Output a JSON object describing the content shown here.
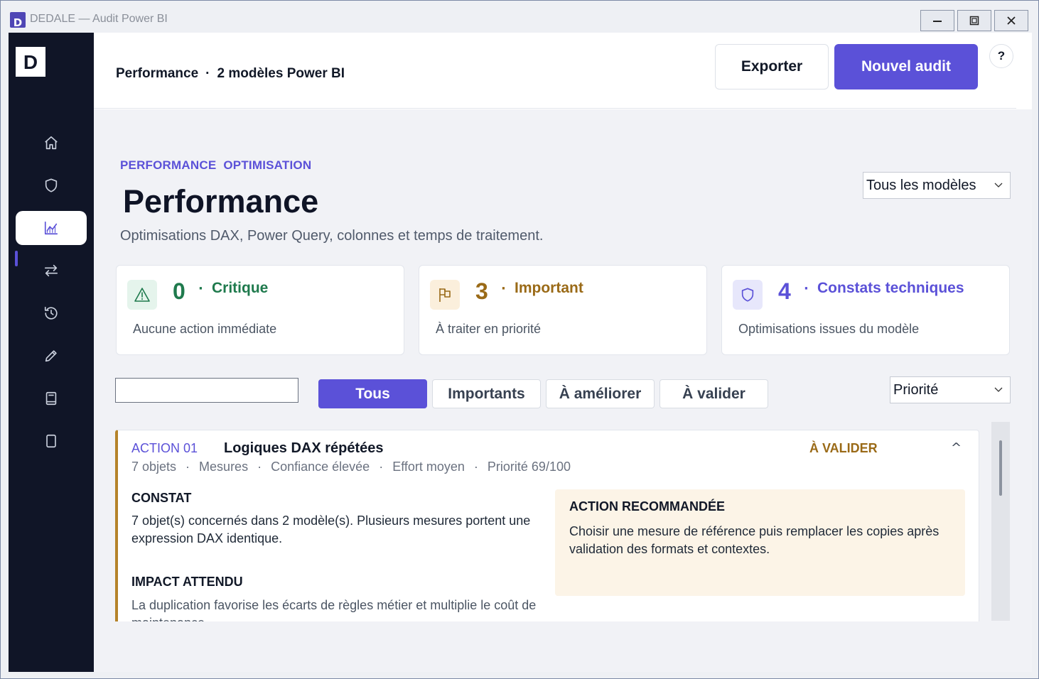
{
  "window": {
    "app_icon_letter": "D",
    "title": "DEDALE — Audit Power BI"
  },
  "sidebar": {
    "logo": "D",
    "items": [
      {
        "icon": "home-icon"
      },
      {
        "icon": "shield-icon"
      },
      {
        "icon": "chart-icon",
        "active": true
      },
      {
        "icon": "swap-arrows-icon"
      },
      {
        "icon": "history-icon"
      },
      {
        "icon": "pencil-icon"
      },
      {
        "icon": "book-icon"
      },
      {
        "icon": "document-icon"
      }
    ]
  },
  "header": {
    "breadcrumb_section": "Performance",
    "breadcrumb_sep": "·",
    "breadcrumb_detail": "2 modèles Power BI",
    "export_label": "Exporter",
    "new_audit_label": "Nouvel audit",
    "help_label": "?"
  },
  "page": {
    "eyebrow_1": "PERFORMANCE",
    "eyebrow_2": "OPTIMISATION",
    "title": "Performance",
    "subtitle": "Optimisations DAX, Power Query, colonnes et temps de traitement.",
    "model_select_value": "Tous les modèles"
  },
  "stats": [
    {
      "count": "0",
      "dot": "·",
      "label": "Critique",
      "desc": "Aucune action immédiate",
      "icon": "warning-icon",
      "color": "#1f7a4d"
    },
    {
      "count": "3",
      "dot": "·",
      "label": "Important",
      "desc": "À traiter en priorité",
      "icon": "flag-icon",
      "color": "#9a6a17"
    },
    {
      "count": "4",
      "dot": "·",
      "label": "Constats techniques",
      "desc": "Optimisations issues du modèle",
      "icon": "shield-icon",
      "color": "#5b51d8"
    }
  ],
  "filters": {
    "search_value": "",
    "chips": [
      "Tous",
      "Importants",
      "À améliorer",
      "À valider"
    ],
    "active_chip": "Tous",
    "sort_value": "Priorité"
  },
  "action": {
    "code": "ACTION 01",
    "title": "Logiques DAX répétées",
    "status": "À VALIDER",
    "toggle": "^",
    "meta": [
      "7 objets",
      "Mesures",
      "Confiance élevée",
      "Effort moyen",
      "Priorité 69/100"
    ],
    "meta_sep": "·",
    "constat_heading": "CONSTAT",
    "constat_text": "7 objet(s) concernés dans 2 modèle(s). Plusieurs mesures portent une expression DAX identique.",
    "impact_heading": "IMPACT ATTENDU",
    "impact_text": "La duplication favorise les écarts de règles métier et multiplie le coût de maintenance.",
    "reco_heading": "ACTION RECOMMANDÉE",
    "reco_text": "Choisir une mesure de référence puis remplacer les copies après validation des formats et contextes."
  },
  "colors": {
    "accent": "#5b51d8",
    "sidebar_bg": "#101527",
    "warning": "#9a6a17",
    "success": "#1f7a4d"
  }
}
